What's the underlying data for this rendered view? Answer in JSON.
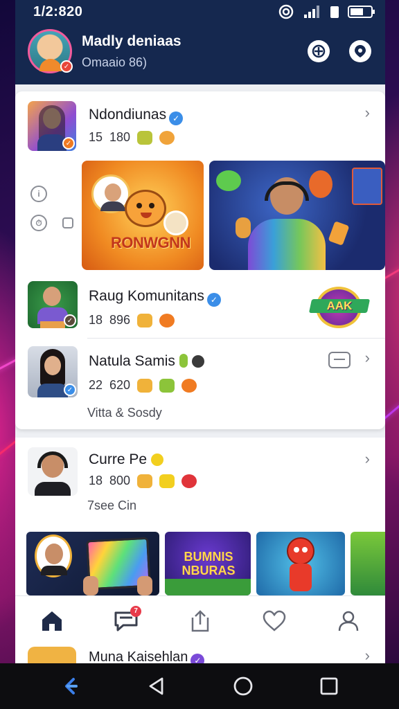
{
  "status_bar": {
    "time": "1/2:820"
  },
  "header": {
    "name": "Madly deniaas",
    "subtitle": "Omaaio 86)",
    "buttons": [
      "add-friend-icon",
      "location-icon"
    ]
  },
  "feed": [
    {
      "title": "Ndondiunas",
      "verified": true,
      "meta_a": "15",
      "meta_b": "180",
      "accent": "#f07b22"
    },
    {
      "banner_left_label": "RONWGNN"
    },
    {
      "title": "Raug Komunitans",
      "verified": true,
      "meta_a": "18",
      "meta_b": "896",
      "badge_text": "AAK"
    },
    {
      "title": "Natula Samis",
      "meta_a": "22",
      "meta_b": "620",
      "subtitle": "Vitta & Sosdy"
    },
    {
      "title": "Curre Pe",
      "meta_a": "18",
      "meta_b": "800",
      "subtitle": "7see Cin"
    }
  ],
  "gallery": {
    "label": "BUMNIS NBURAS"
  },
  "bottom_nav": {
    "items": [
      "home-icon",
      "chat-icon",
      "share-icon",
      "heart-icon",
      "profile-icon"
    ],
    "chat_badge": "7"
  },
  "peek": {
    "title": "Muna Kaisehlan"
  },
  "colors": {
    "header_bg": "#15284f",
    "verified_blue": "#3b8ee8",
    "accent_orange": "#f07b22"
  }
}
